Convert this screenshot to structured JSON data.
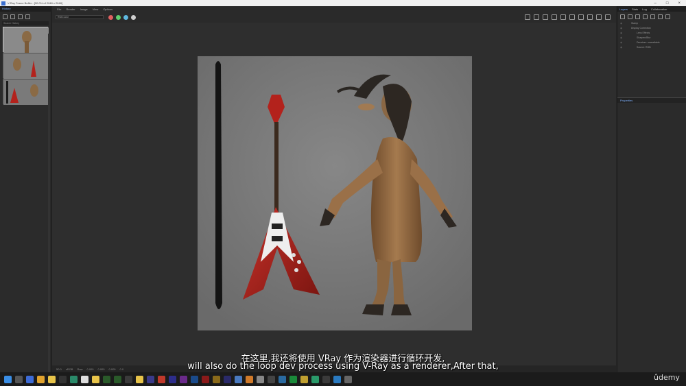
{
  "window": {
    "title": "V-Ray Frame Buffer - [50.0% of 2048 x 2048]"
  },
  "left_panel": {
    "tab": "History",
    "search_placeholder": "Search History"
  },
  "menu": [
    "File",
    "Render",
    "Image",
    "View",
    "Options"
  ],
  "toolbar": {
    "channel": "RGB color"
  },
  "right_panel": {
    "tabs": [
      "Layers",
      "Stats",
      "Log",
      "Collaboration"
    ],
    "layers": [
      {
        "name": "Stamp"
      },
      {
        "name": "Display Correction"
      },
      {
        "name": "Lens Effects"
      },
      {
        "name": "Sharpen/Blur"
      },
      {
        "name": "Denoiser: unavailable"
      },
      {
        "name": "Source: RGB"
      }
    ],
    "properties_label": "Properties"
  },
  "bottom_bar": {
    "zoom": "50.0",
    "items": [
      "sRGB",
      "Raw",
      "0.000",
      "0.000",
      "0.000",
      "0.0"
    ]
  },
  "subtitles": {
    "zh": "在这里,我还将使用 VRay 作为渲染器进行循环开发,",
    "en": "will also do the loop dev process using V-Ray as a renderer,After that,"
  },
  "watermark": "ûdemy",
  "colors": {
    "accent": "#7fb2ff",
    "guitar_red": "#b3221c",
    "goat_fur": "#9a7048",
    "render_bg": "#7b7b7b"
  },
  "taskbar_apps": [
    "windows-icon",
    "settings-icon",
    "search-icon",
    "chrome-icon",
    "explorer-icon",
    "unreal-icon",
    "app-icon",
    "app-icon",
    "app-icon",
    "app-icon",
    "app-icon",
    "app-icon",
    "app-icon",
    "app-icon",
    "app-icon",
    "app-icon",
    "app-icon",
    "app-icon",
    "app-icon",
    "app-icon",
    "app-icon",
    "app-icon",
    "app-icon",
    "app-icon",
    "app-icon",
    "app-icon",
    "app-icon",
    "app-icon",
    "app-icon",
    "app-icon",
    "app-icon",
    "app-icon"
  ]
}
